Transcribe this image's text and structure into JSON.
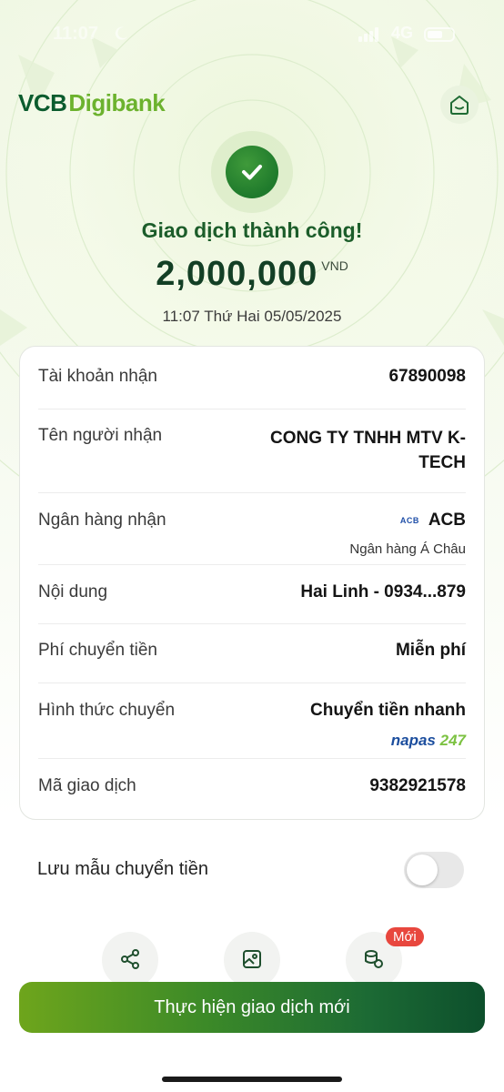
{
  "status_bar": {
    "time": "11:07",
    "network": "4G"
  },
  "header": {
    "logo_vcb": "VCB",
    "logo_digibank": "Digibank"
  },
  "result": {
    "title": "Giao dịch thành công!",
    "amount": "2,000,000",
    "currency": "VND",
    "datetime": "11:07 Thứ Hai 05/05/2025"
  },
  "details": {
    "account_label": "Tài khoản nhận",
    "account_value": "67890098",
    "recipient_label": "Tên người nhận",
    "recipient_line1": "CONG TY TNHH MTV K-",
    "recipient_line2": "TECH",
    "bank_label": "Ngân hàng nhận",
    "bank_logo_text": "ACB",
    "bank_code": "ACB",
    "bank_full_name": "Ngân hàng Á Châu",
    "content_label": "Nội dung",
    "content_value": "Hai Linh - 0934...879",
    "fee_label": "Phí chuyển tiền",
    "fee_value": "Miễn phí",
    "method_label": "Hình thức chuyển",
    "method_value": "Chuyển tiền nhanh",
    "napas_part1": "napas",
    "napas_part2": "247",
    "txn_label": "Mã giao dịch",
    "txn_value": "9382921578"
  },
  "save_template": {
    "label": "Lưu mẫu chuyển tiền",
    "enabled": false
  },
  "quick_actions": {
    "new_badge": "Mới"
  },
  "cta": {
    "label": "Thực hiện giao dịch mới"
  },
  "colors": {
    "brand_dark": "#0b5c2e",
    "brand_light": "#6cb22e",
    "success": "#1f7a2c",
    "badge": "#e8473e"
  }
}
